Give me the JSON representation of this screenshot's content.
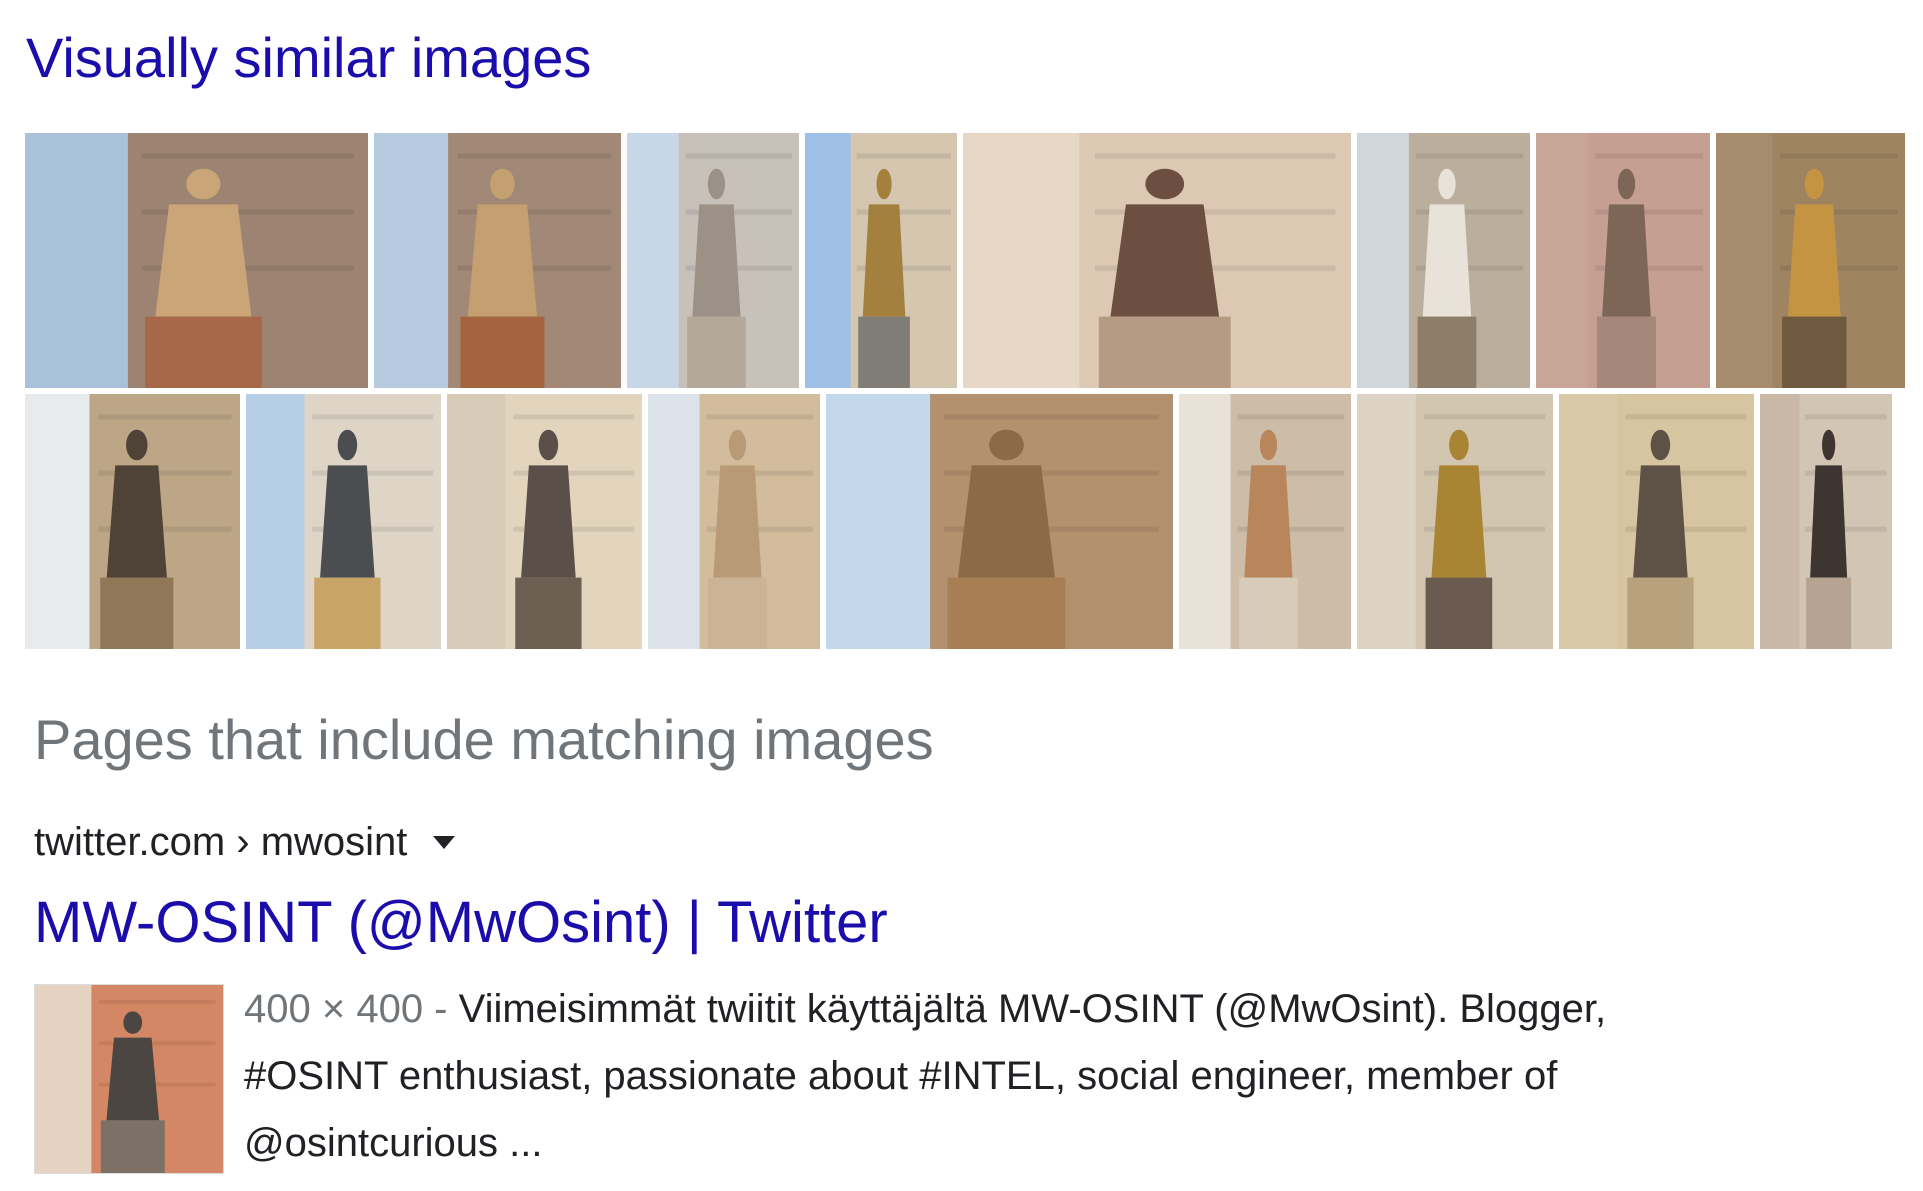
{
  "similar": {
    "heading": "Visually similar images",
    "row1": [
      {
        "name": "statue-tower-1",
        "sky": "#a9c2da",
        "wall": "#9b7d66",
        "figure": "#c9a577",
        "base": "#a7684a"
      },
      {
        "name": "statue-tower-2",
        "sky": "#b7cbe0",
        "wall": "#a0816b",
        "figure": "#c49f70",
        "base": "#a3643f"
      },
      {
        "name": "statue-column-niche",
        "sky": "#c8d7e8",
        "wall": "#c8bfb5",
        "figure": "#9c9187",
        "base": "#b3a899"
      },
      {
        "name": "gilded-statue",
        "sky": "#9fc0e6",
        "wall": "#d9c6a8",
        "figure": "#a4803f",
        "base": "#7f7d76"
      },
      {
        "name": "relief-panel",
        "sky": "#e6d7c6",
        "wall": "#dcc7b1",
        "figure": "#6c4f40",
        "base": "#b69b84"
      },
      {
        "name": "white-marble-statue",
        "sky": "#cfd6dc",
        "wall": "#b8aa95",
        "figure": "#e8e2d8",
        "base": "#8e7d68"
      },
      {
        "name": "niche-statue",
        "sky": "#c7a597",
        "wall": "#c59e92",
        "figure": "#7d6656",
        "base": "#a6877a"
      },
      {
        "name": "golden-statue-interior",
        "sky": "#a58c6d",
        "wall": "#9d835f",
        "figure": "#c49442",
        "base": "#6f5a40"
      }
    ],
    "row2": [
      {
        "name": "olympic-rings-statue",
        "sky": "#e8ebee",
        "wall": "#b79f7a",
        "figure": "#4f4236",
        "base": "#8f7757"
      },
      {
        "name": "pavilion-statue",
        "sky": "#b5cde5",
        "wall": "#e2d6c2",
        "figure": "#4b4d50",
        "base": "#c9a467"
      },
      {
        "name": "church-facade",
        "sky": "#d7cbb7",
        "wall": "#e4d6be",
        "figure": "#5a5049",
        "base": "#6d5f51"
      },
      {
        "name": "angled-column-statue",
        "sky": "#dde3ea",
        "wall": "#d0b794",
        "figure": "#b89b76",
        "base": "#cbb496"
      },
      {
        "name": "egyptian-columns-obelisk",
        "sky": "#c4d8ec",
        "wall": "#b18a60",
        "figure": "#8b6a47",
        "base": "#a87f55"
      },
      {
        "name": "flame-pillars",
        "sky": "#e9e2d9",
        "wall": "#cab8a2",
        "figure": "#b8865a",
        "base": "#d9cbb9"
      },
      {
        "name": "ornate-wall-monument",
        "sky": "#ddd3c4",
        "wall": "#d2c4af",
        "figure": "#a88433",
        "base": "#6b5a4f"
      },
      {
        "name": "framed-niche-statue",
        "sky": "#d9c9a8",
        "wall": "#d6c39f",
        "figure": "#5d5245",
        "base": "#b8a27e"
      },
      {
        "name": "funerary-monument",
        "sky": "#c9b8a6",
        "wall": "#d3c6b6",
        "figure": "#3e3430",
        "base": "#b7a391"
      }
    ]
  },
  "pages": {
    "heading": "Pages that include matching images"
  },
  "result": {
    "cite_domain": "twitter.com",
    "cite_sep": " › ",
    "cite_path": "mwosint",
    "title": "MW-OSINT (@MwOsint) | Twitter",
    "dimensions": "400 × 400",
    "dim_sep": " - ",
    "snippet": "Viimeisimmät twiitit käyttäjältä MW-OSINT (@MwOsint). Blogger, #OSINT enthusiast, passionate about #INTEL, social engineer, member of @osintcurious ...",
    "thumb": {
      "sky": "#e6d2c0",
      "wall": "#d27e5a",
      "figure": "#4b4641",
      "base": "#7d7066"
    }
  }
}
